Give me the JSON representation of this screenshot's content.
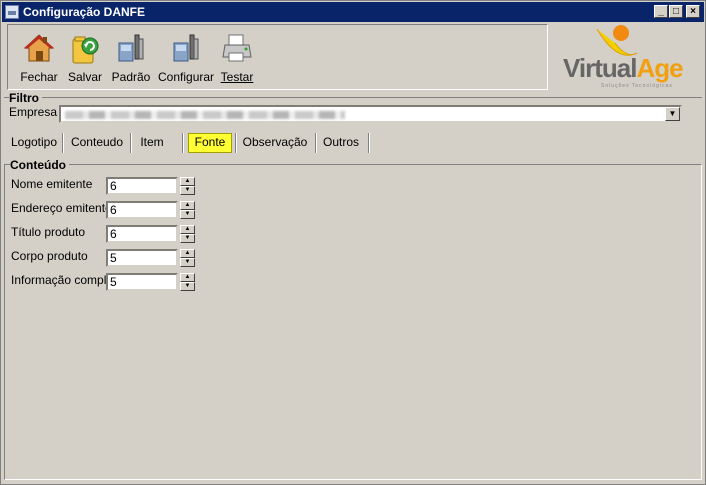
{
  "window": {
    "title": "Configuração DANFE"
  },
  "titlebar_buttons": {
    "minimize": "_",
    "maximize": "□",
    "close": "×"
  },
  "toolbar": {
    "items": [
      {
        "label": "Fechar",
        "icon": "house-icon"
      },
      {
        "label": "Salvar",
        "icon": "save-folder-icon"
      },
      {
        "label": "Padrão",
        "icon": "default-tools-icon"
      },
      {
        "label": "Configurar",
        "icon": "configure-tools-icon"
      },
      {
        "label": "Testar",
        "icon": "printer-icon"
      }
    ]
  },
  "logo": {
    "text_main": "Virtual",
    "text_accent": "Age",
    "subtitle": "Soluções Tecnológicas"
  },
  "filtro": {
    "title": "Filtro",
    "empresa_label": "Empresa"
  },
  "tabs": [
    {
      "label": "Logotipo"
    },
    {
      "label": "Conteudo"
    },
    {
      "label": "Item"
    },
    {
      "label": "Fonte",
      "active": true
    },
    {
      "label": "Observação"
    },
    {
      "label": "Outros"
    }
  ],
  "conteudo": {
    "title": "Conteúdo",
    "fields": [
      {
        "label": "Nome emitente",
        "value": "6"
      },
      {
        "label": "Endereço emitente",
        "value": "6"
      },
      {
        "label": "Título produto",
        "value": "6"
      },
      {
        "label": "Corpo produto",
        "value": "5"
      },
      {
        "label": "Informação compl.",
        "value": "5"
      }
    ]
  },
  "colors": {
    "titlebar": "#0a246a",
    "active_tab": "#ffff33",
    "window_bg": "#d4d0c8"
  }
}
